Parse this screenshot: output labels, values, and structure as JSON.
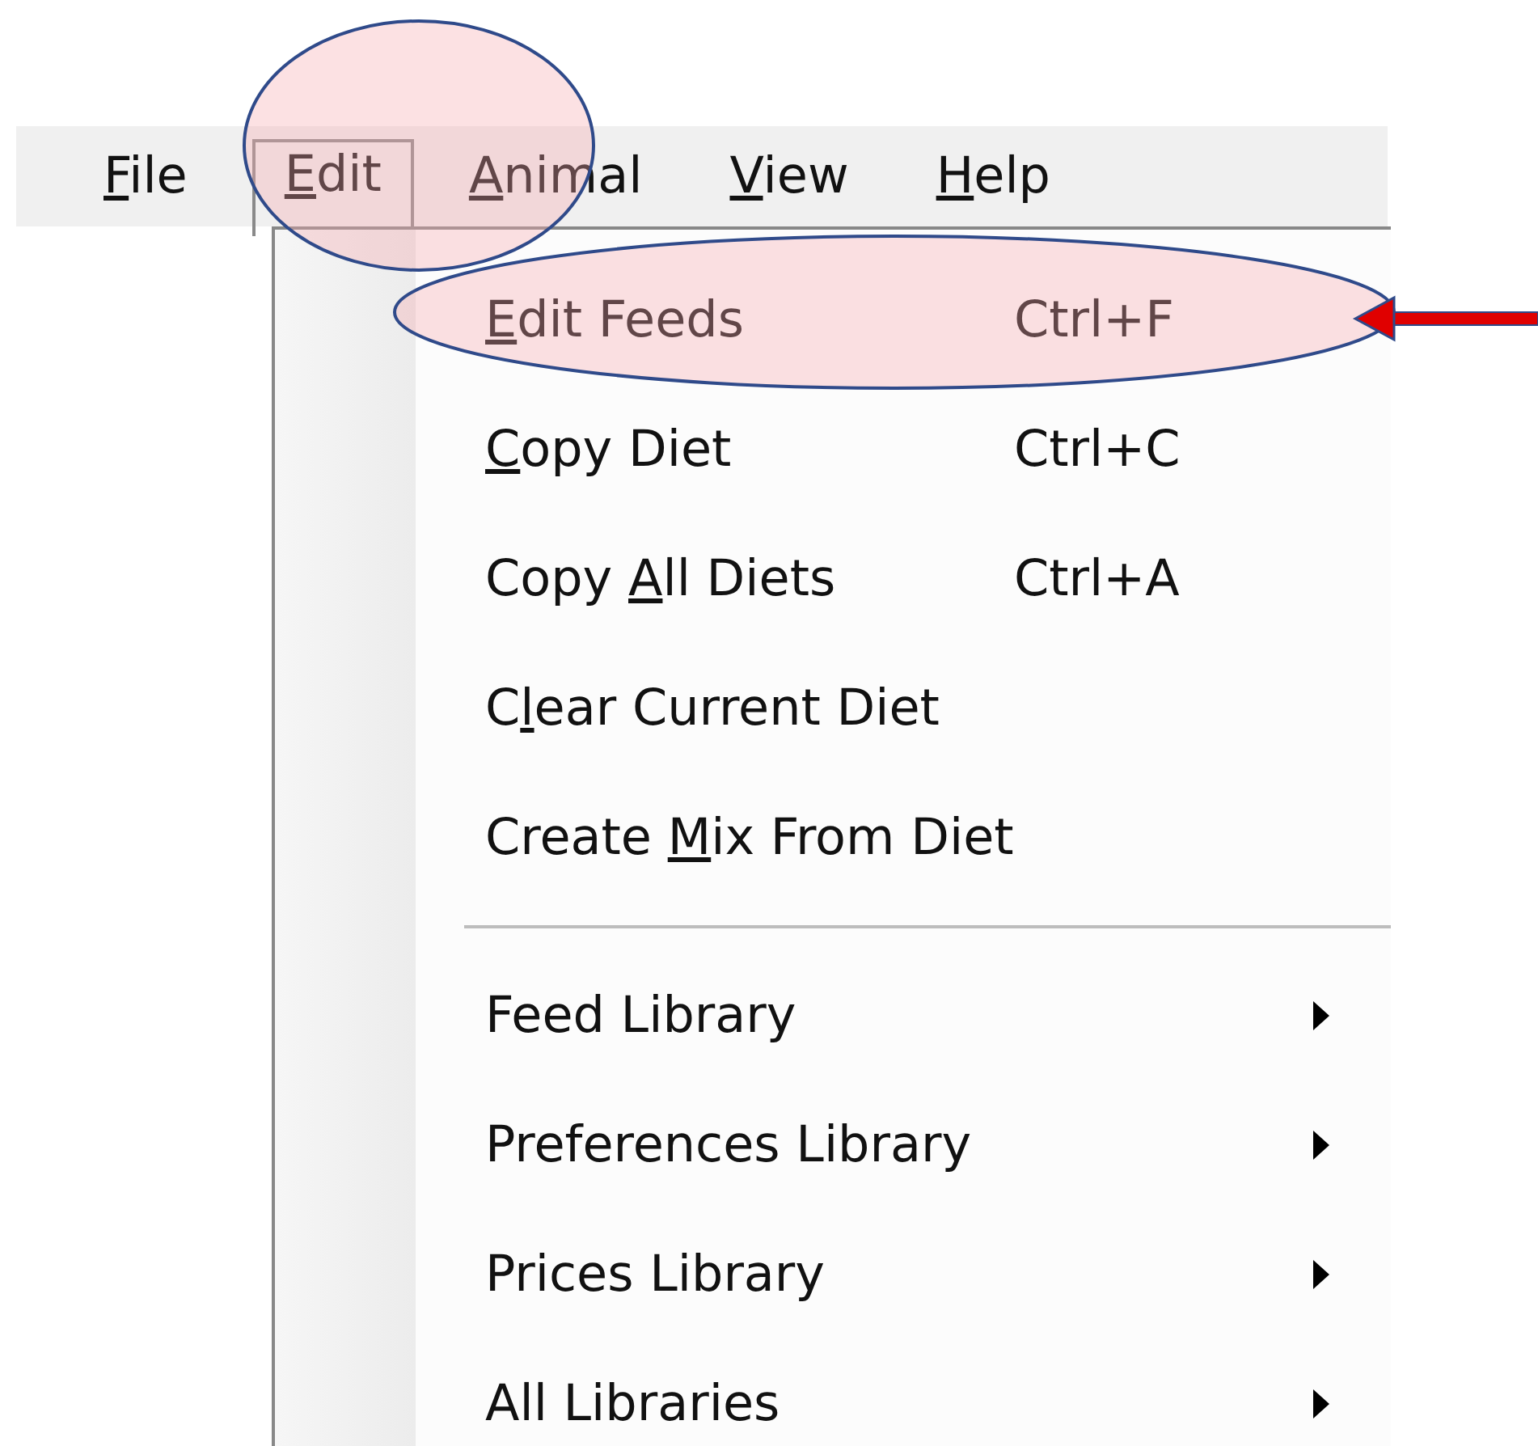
{
  "menu_bar": [
    {
      "key": "F",
      "post": "ile",
      "selected": false
    },
    {
      "key": "E",
      "post": "dit",
      "selected": true
    },
    {
      "key": "A",
      "post": "nimal",
      "selected": false
    },
    {
      "key": "V",
      "post": "iew",
      "selected": false
    },
    {
      "key": "H",
      "post": "elp",
      "selected": false
    }
  ],
  "edit_menu": [
    {
      "kind": "command",
      "key": "E",
      "post": "dit Feeds",
      "shortcut": "Ctrl+F"
    },
    {
      "kind": "command",
      "key": "C",
      "post": "opy Diet",
      "shortcut": "Ctrl+C"
    },
    {
      "kind": "command",
      "pre": "Copy ",
      "key": "A",
      "post": "ll Diets",
      "shortcut": "Ctrl+A"
    },
    {
      "kind": "command",
      "pre": "C",
      "key": "l",
      "post": "ear Current Diet"
    },
    {
      "kind": "command",
      "pre": "Create ",
      "key": "M",
      "post": "ix From Diet"
    },
    {
      "kind": "separator"
    },
    {
      "kind": "submenu",
      "pre": "Feed Library"
    },
    {
      "kind": "submenu",
      "pre": "Preferences Library"
    },
    {
      "kind": "submenu",
      "pre": "Prices Library"
    },
    {
      "kind": "submenu",
      "pre": "All Libraries"
    }
  ]
}
